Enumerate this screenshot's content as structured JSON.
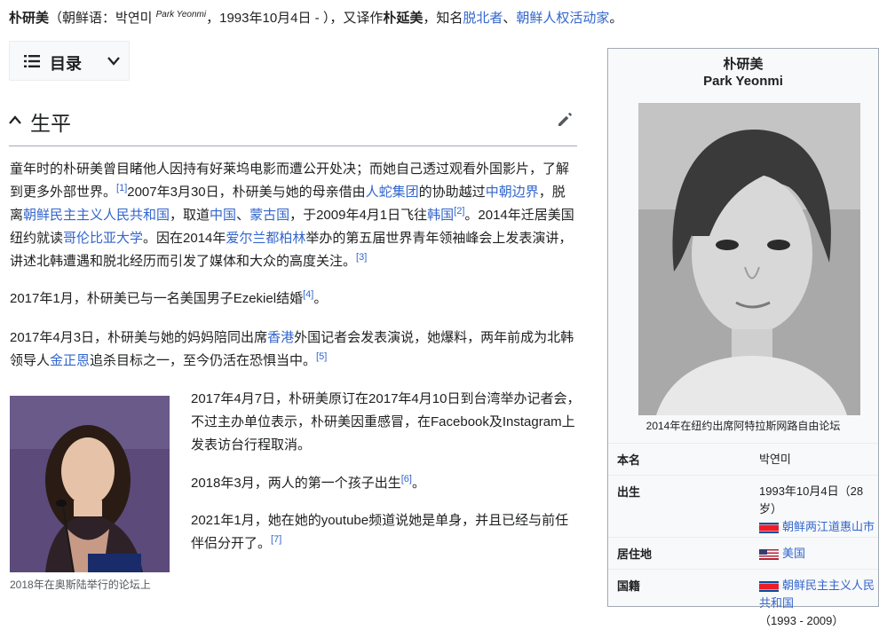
{
  "intro": {
    "name_bold": "朴研美",
    "paren_open": "（朝鲜语：박연미 ",
    "romanized": "Park Yeonmi",
    "dates": "，1993年10月4日 - ），又译作",
    "alt_name": "朴延美",
    "known_as": "，知名",
    "link1": "脱北者",
    "sep": "、",
    "link2": "朝鲜人权活动家",
    "end": "。"
  },
  "toc": {
    "label": "目录"
  },
  "section": {
    "title": "生平"
  },
  "p1": {
    "t1": "童年时的朴研美曾目睹他人因持有好莱坞电影而遭公开处决；而她自己透过观看外国影片，了解到更多外部世界。",
    "r1": "[1]",
    "t2": "2007年3月30日，朴研美与她的母亲借由",
    "l1": "人蛇集团",
    "t3": "的协助越过",
    "l2": "中朝边界",
    "t4": "，脱离",
    "l3": "朝鲜民主主义人民共和国",
    "t5": "，取道",
    "l4": "中国",
    "t6": "、",
    "l5": "蒙古国",
    "t7": "，于2009年4月1日飞往",
    "l6": "韩国",
    "r2": "[2]",
    "t8": "。2014年迁居美国纽约就读",
    "l7": "哥伦比亚大学",
    "t9": "。因在2014年",
    "l8": "爱尔兰都柏林",
    "t10": "举办的第五届世界青年领袖峰会上发表演讲，讲述北韩遭遇和脱北经历而引发了媒体和大众的高度关注。",
    "r3": "[3]"
  },
  "p2": {
    "t1": "2017年1月，朴研美已与一名美国男子Ezekiel结婚",
    "r1": "[4]",
    "t2": "。"
  },
  "p3": {
    "t1": "2017年4月3日，朴研美与她的妈妈陪同出席",
    "l1": "香港",
    "t2": "外国记者会发表演说，她爆料，两年前成为北韩领导人",
    "l2": "金正恩",
    "t3": "追杀目标之一，至今仍活在恐惧当中。",
    "r1": "[5]"
  },
  "p4": {
    "t1": "2017年4月7日，朴研美原订在2017年4月10日到台湾举办记者会，不过主办单位表示，朴研美因重感冒，在Facebook及Instagram上发表访台行程取消。"
  },
  "p5": {
    "t1": "2018年3月，两人的第一个孩子出生",
    "r1": "[6]",
    "t2": "。"
  },
  "p6": {
    "t1": "2021年1月，她在她的youtube频道说她是单身，并且已经与前任伴侣分开了。",
    "r1": "[7]"
  },
  "thumb": {
    "caption": "2018年在奥斯陆举行的论坛上"
  },
  "infobox": {
    "title_zh": "朴研美",
    "title_en": "Park Yeonmi",
    "caption": "2014年在纽约出席阿特拉斯网路自由论坛",
    "rows": [
      {
        "label": "本名",
        "value": "박연미"
      },
      {
        "label": "出生",
        "value": "1993年10月4日（28岁）",
        "link": "朝鲜两江道惠山市"
      },
      {
        "label": "居住地",
        "link": "美国"
      },
      {
        "label": "国籍",
        "link": "朝鲜民主主义人民共和国",
        "value": "（1993 - 2009）"
      }
    ]
  },
  "colors": {
    "link": "#3366cc",
    "text": "#202122",
    "infobox_bg": "#f8f9fa",
    "border": "#a2a9b1"
  }
}
